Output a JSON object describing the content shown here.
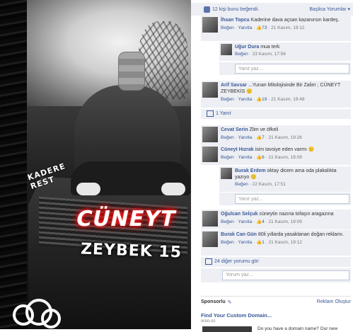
{
  "photo": {
    "plate_text": "KADERE\nREST",
    "name_line1": "CÜNEYT",
    "name_line2": "ZEYBEK 15"
  },
  "panel": {
    "likes_text": "12 kişi bunu beğendi.",
    "language_link": "Başlica Yorumlar ▾",
    "reply_placeholder": "Yanıt yaz...",
    "comment_placeholder": "Yorum yaz...",
    "one_reply_label": "1 Yanıt",
    "more_comments_label": "24 diğer yorumu gör",
    "comments": [
      {
        "author": "İhsan Topcu",
        "text": "Kaderine dava açsan kazanırsın kardeş.",
        "like_link": "Beğen",
        "reply_link": "Yanıtla",
        "likes": "73",
        "date": "21 Kasım, 19:12"
      },
      {
        "author": "Uğur Dura",
        "text": "mua terk",
        "like_link": "Beğen",
        "reply_link": "",
        "likes": "",
        "date": "23 Kasım, 17:56"
      },
      {
        "author": "Arif Savsar",
        "text": "...Yunan Mitolojisinde Bir Zalim ; CÜNEYT ZEYBEKİS",
        "like_link": "Beğen",
        "reply_link": "Yanıtla",
        "likes": "19",
        "date": "21 Kasım, 19:48"
      },
      {
        "author": "Cevat Serin",
        "text": "Zlim ve öfkeli",
        "like_link": "Beğen",
        "reply_link": "Yanıtla",
        "likes": "7",
        "date": "21 Kasım, 19:26"
      },
      {
        "author": "Cüneyt Hızrak",
        "text": "isim tavsiye eden varmı",
        "like_link": "Beğen",
        "reply_link": "Yanıtla",
        "likes": "6",
        "date": "21 Kasım, 19:09"
      },
      {
        "author": "Burak Erdem",
        "text": "oktay dicem ama oda plakalıkta yazıyo",
        "like_link": "Beğen",
        "reply_link": "",
        "likes": "",
        "date": "22 Kasım, 17:51"
      },
      {
        "author": "Oğulcan Selçuk",
        "text": "cüneytin nazına tofaşın aragazına",
        "like_link": "Beğen",
        "reply_link": "Yanıtla",
        "likes": "4",
        "date": "21 Kasım, 19:09"
      },
      {
        "author": "Burak Can Gün",
        "text": "80li yıllarda yasaklanan doğan reklamı.",
        "like_link": "Beğen",
        "reply_link": "Yanıtla",
        "likes": "1",
        "date": "21 Kasım, 19:12"
      }
    ],
    "sponsored": {
      "label": "Sponsorlu",
      "create_ad": "Reklam Oluştur",
      "ad_title": "Find Your Custom Domain...",
      "ad_url": "vrsn.cc",
      "ad_text": "Do you have a domain name? Our new"
    }
  }
}
